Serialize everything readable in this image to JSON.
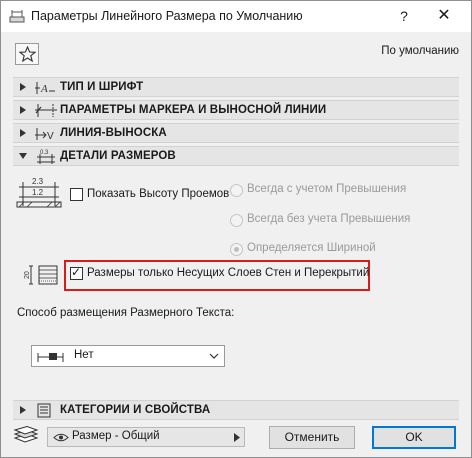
{
  "window": {
    "title": "Параметры Линейного Размера по Умолчанию",
    "help_glyph": "?",
    "close_glyph": "✕"
  },
  "toolbar": {
    "favorites_icon": "star-icon",
    "defaults_label": "По умолчанию"
  },
  "panels": [
    {
      "label": "ТИП И ШРИФТ",
      "expanded": false,
      "icon": "text-font-icon"
    },
    {
      "label": "ПАРАМЕТРЫ МАРКЕРА И ВЫНОСНОЙ ЛИНИИ",
      "expanded": false,
      "icon": "marker-witness-line-icon"
    },
    {
      "label": "ЛИНИЯ-ВЫНОСКА",
      "expanded": false,
      "icon": "leader-line-icon"
    },
    {
      "label": "ДЕТАЛИ РАЗМЕРОВ",
      "expanded": true,
      "icon": "dimension-details-icon"
    },
    {
      "label": "КАТЕГОРИИ И СВОЙСТВА",
      "expanded": false,
      "icon": "properties-list-icon"
    }
  ],
  "details": {
    "icon_numbers": {
      "top": "2.3",
      "bottom": "1.2"
    },
    "show_opening_height": {
      "label": "Показать Высоту Проемов",
      "checked": false
    },
    "radio_options": [
      {
        "label": "Всегда с учетом Превышения",
        "selected": false,
        "enabled": false
      },
      {
        "label": "Всегда без учета Превышения",
        "selected": false,
        "enabled": false
      },
      {
        "label": "Определяется Шириной",
        "selected": true,
        "enabled": false
      }
    ],
    "hatch_icon_number": "20",
    "core_only": {
      "label": "Размеры только Несущих Слоев Стен и Перекрытий",
      "checked": true
    },
    "highlight_color": "#d81b1b"
  },
  "placement": {
    "label": "Способ размещения Размерного Текста:",
    "selected": "Нет",
    "icon": "text-placement-icon"
  },
  "footer": {
    "layer_icon": "layers-icon",
    "layer_value": "Размер - Общий",
    "cancel_label": "Отменить",
    "ok_label": "OK",
    "accent": "#0078d7"
  }
}
